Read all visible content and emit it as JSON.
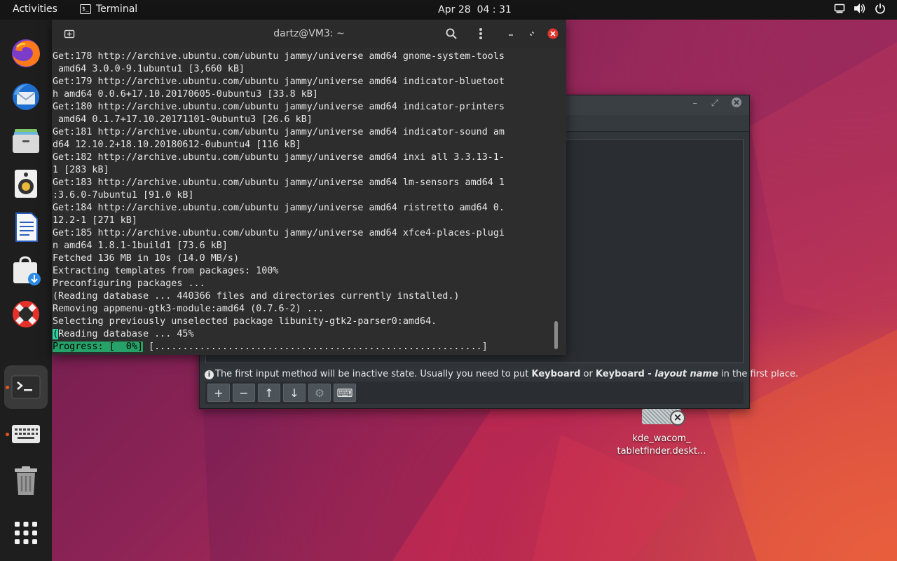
{
  "topbar": {
    "activities": "Activities",
    "app_name": "Terminal",
    "app_icon_text": "$_",
    "date": "Apr 28",
    "time": "04 : 31",
    "tray_icons": [
      "display-icon",
      "volume-icon",
      "power-icon"
    ]
  },
  "dock": {
    "items": [
      {
        "name": "firefox",
        "running": false
      },
      {
        "name": "thunderbird",
        "running": false
      },
      {
        "name": "files",
        "running": false
      },
      {
        "name": "rhythmbox",
        "running": false
      },
      {
        "name": "libreoffice-writer",
        "running": false
      },
      {
        "name": "software-install",
        "running": false
      },
      {
        "name": "help",
        "running": false
      },
      {
        "name": "terminal",
        "running": true,
        "active": true
      },
      {
        "name": "keyboard-input-method",
        "running": true
      },
      {
        "name": "trash",
        "running": false
      },
      {
        "name": "show-applications",
        "running": false
      }
    ]
  },
  "terminal": {
    "title": "dartz@VM3: ~",
    "lines": [
      "Get:178 http://archive.ubuntu.com/ubuntu jammy/universe amd64 gnome-system-tools",
      " amd64 3.0.0-9.1ubuntu1 [3,660 kB]",
      "Get:179 http://archive.ubuntu.com/ubuntu jammy/universe amd64 indicator-bluetoot",
      "h amd64 0.0.6+17.10.20170605-0ubuntu3 [33.8 kB]",
      "Get:180 http://archive.ubuntu.com/ubuntu jammy/universe amd64 indicator-printers",
      " amd64 0.1.7+17.10.20171101-0ubuntu3 [26.6 kB]",
      "Get:181 http://archive.ubuntu.com/ubuntu jammy/universe amd64 indicator-sound am",
      "d64 12.10.2+18.10.20180612-0ubuntu4 [116 kB]",
      "Get:182 http://archive.ubuntu.com/ubuntu jammy/universe amd64 inxi all 3.3.13-1-",
      "1 [283 kB]",
      "Get:183 http://archive.ubuntu.com/ubuntu jammy/universe amd64 lm-sensors amd64 1",
      ":3.6.0-7ubuntu1 [91.0 kB]",
      "Get:184 http://archive.ubuntu.com/ubuntu jammy/universe amd64 ristretto amd64 0.",
      "12.2-1 [271 kB]",
      "Get:185 http://archive.ubuntu.com/ubuntu jammy/universe amd64 xfce4-places-plugi",
      "n amd64 1.8.1-1build1 [73.6 kB]",
      "Fetched 136 MB in 10s (14.0 MB/s)",
      "Extracting templates from packages: 100%",
      "Preconfiguring packages ...",
      "(Reading database ... 440366 files and directories currently installed.)",
      "Removing appmenu-gtk3-module:amd64 (0.7.6-2) ...",
      "Selecting previously unselected package libunity-gtk2-parser0:amd64."
    ],
    "cursor_char": "(",
    "current_line_rest": "Reading database ... 45%",
    "progress_label": "Progress: [  0%]",
    "progress_bar": " [..........................................................]"
  },
  "im_window": {
    "hint_prefix": "The first input method will be inactive state. Usually you need to put ",
    "hint_bold1": "Keyboard",
    "hint_mid": " or ",
    "hint_bold2": "Keyboard - ",
    "hint_italic": "layout name",
    "hint_suffix": " in the first place.",
    "toolbar": [
      {
        "name": "add-icon",
        "glyph": "+"
      },
      {
        "name": "remove-icon",
        "glyph": "−"
      },
      {
        "name": "move-up-icon",
        "glyph": "↑"
      },
      {
        "name": "move-down-icon",
        "glyph": "↓"
      },
      {
        "name": "configure-icon",
        "glyph": "⚙"
      },
      {
        "name": "keyboard-layout-icon",
        "glyph": "⌨"
      }
    ]
  },
  "desktop_icon": {
    "label_line1": "kde_wacom_",
    "label_line2": "tabletfinder.deskt..."
  }
}
